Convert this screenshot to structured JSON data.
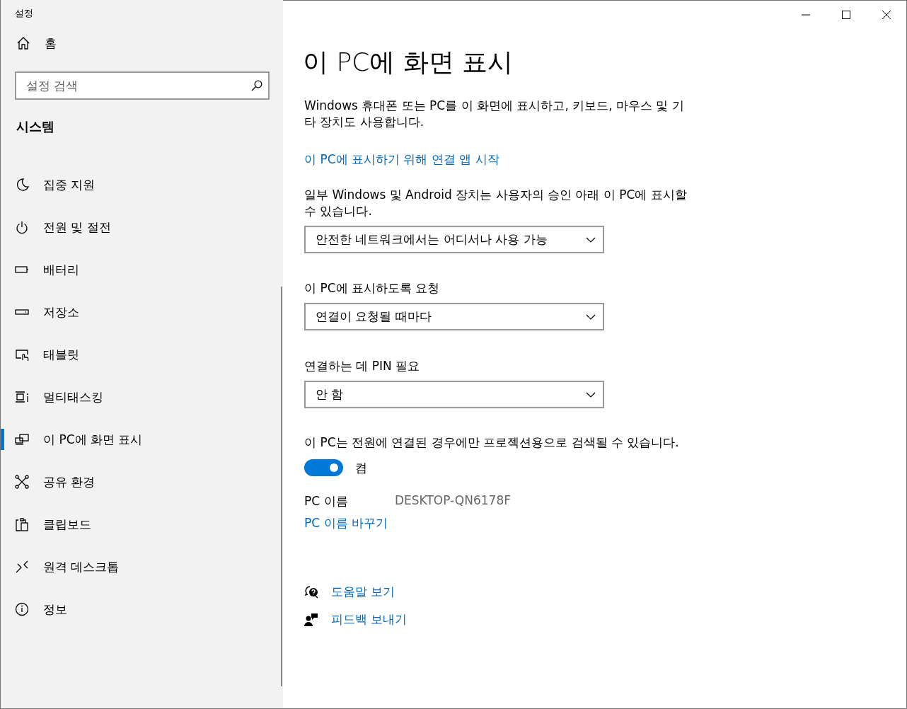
{
  "window": {
    "title": "설정"
  },
  "sidebar": {
    "home": "홈",
    "search": {
      "placeholder": "설정 검색"
    },
    "section": "시스템",
    "items": [
      {
        "label": "집중 지원",
        "selected": false
      },
      {
        "label": "전원 및 절전",
        "selected": false
      },
      {
        "label": "배터리",
        "selected": false
      },
      {
        "label": "저장소",
        "selected": false
      },
      {
        "label": "태블릿",
        "selected": false
      },
      {
        "label": "멀티태스킹",
        "selected": false
      },
      {
        "label": "이 PC에 화면 표시",
        "selected": true
      },
      {
        "label": "공유 환경",
        "selected": false
      },
      {
        "label": "클립보드",
        "selected": false
      },
      {
        "label": "원격 데스크톱",
        "selected": false
      },
      {
        "label": "정보",
        "selected": false
      }
    ]
  },
  "main": {
    "title": "이 PC에 화면 표시",
    "description": "Windows 휴대폰 또는 PC를 이 화면에 표시하고, 키보드, 마우스 및 기타 장치도 사용합니다.",
    "link": "이 PC에 표시하기 위해 연결 앱 시작",
    "settings": [
      {
        "kind": "dropdown",
        "label": "일부 Windows 및 Android 장치는 사용자의 승인 아래 이 PC에 표시할 수 있습니다.",
        "value": "안전한 네트워크에서는 어디서나 사용 가능"
      },
      {
        "kind": "dropdown",
        "label": "이 PC에 표시하도록 요청",
        "value": "연결이 요청될 때마다"
      },
      {
        "kind": "dropdown",
        "label": "연결하는 데 PIN 필요",
        "value": "안 함"
      },
      {
        "kind": "toggle",
        "label": "이 PC는 전원에 연결된 경우에만 프로젝션용으로 검색될 수 있습니다.",
        "on": true,
        "state": "켬"
      }
    ],
    "pc_name": {
      "label": "PC 이름",
      "value": "DESKTOP-QN6178F"
    },
    "rename_link": "PC 이름 바꾸기",
    "help_links": [
      {
        "label": "도움말 보기"
      },
      {
        "label": "피드백 보내기"
      }
    ]
  }
}
